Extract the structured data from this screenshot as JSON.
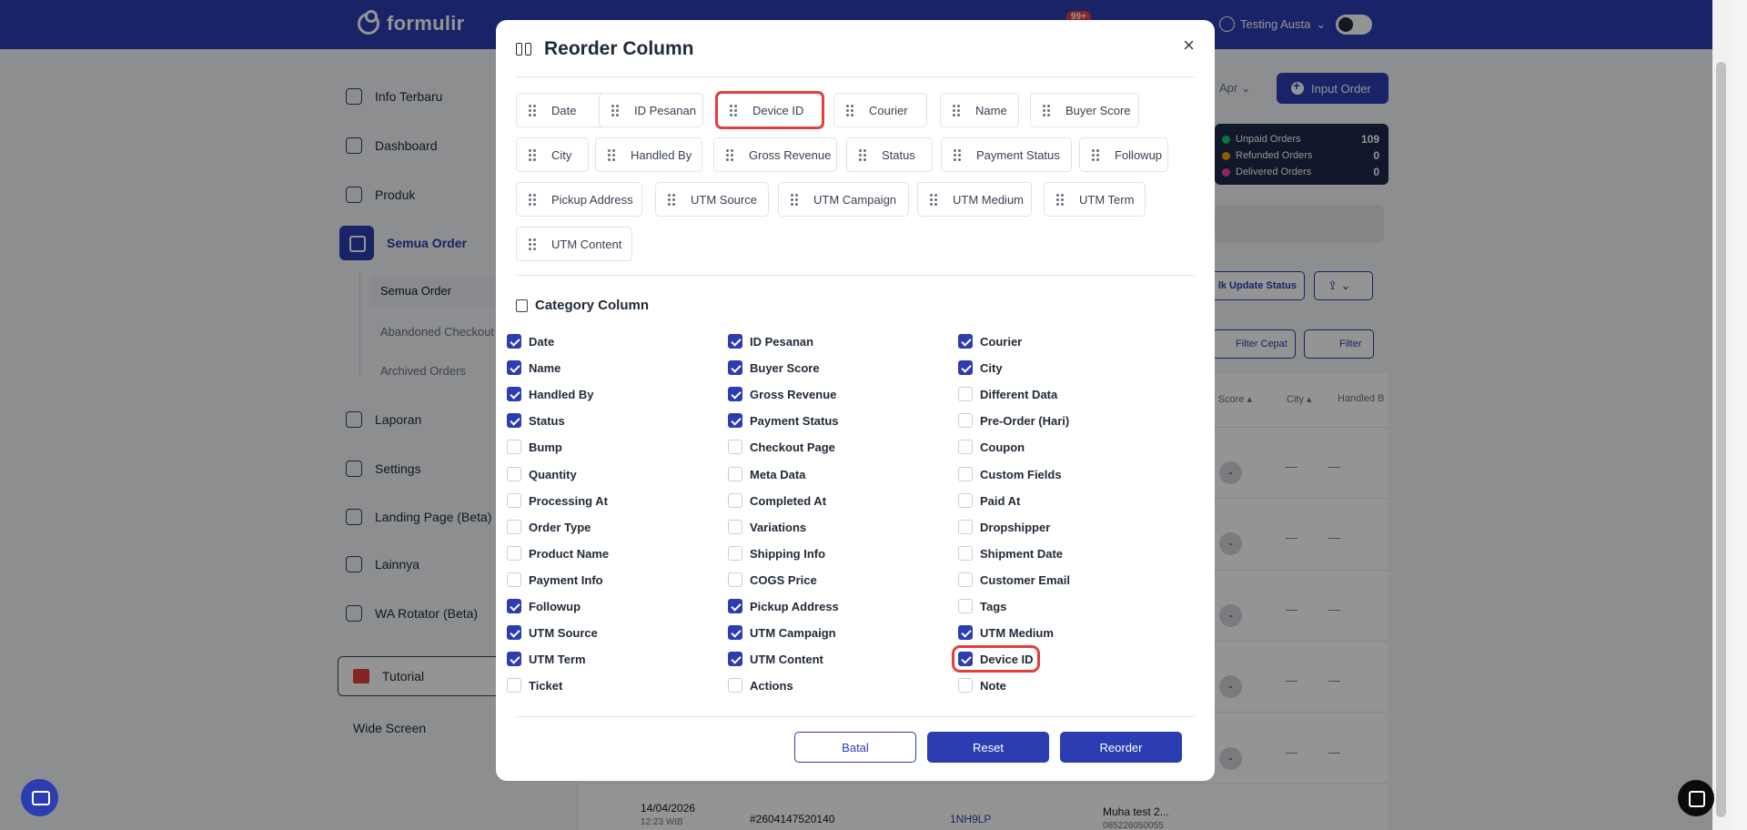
{
  "header": {
    "logo_text": "formulir",
    "notif_count": "99+",
    "user_name": "Testing Austa"
  },
  "sidebar": {
    "items": [
      {
        "label": "Info Terbaru",
        "icon": "megaphone-icon"
      },
      {
        "label": "Dashboard",
        "icon": "dashboard-icon"
      },
      {
        "label": "Produk",
        "icon": "box-icon"
      },
      {
        "label": "Semua Order",
        "icon": "cart-icon",
        "active": true
      },
      {
        "label": "Laporan",
        "icon": "report-icon"
      },
      {
        "label": "Settings",
        "icon": "gear-icon"
      },
      {
        "label": "Landing Page (Beta)",
        "icon": "page-icon"
      },
      {
        "label": "Lainnya",
        "icon": "more-icon"
      },
      {
        "label": "WA Rotator (Beta)",
        "icon": "whatsapp-icon"
      }
    ],
    "sub_items": [
      "Semua Order",
      "Abandoned Checkout",
      "Archived Orders"
    ],
    "tutorial": "Tutorial",
    "wide_screen": "Wide Screen"
  },
  "page": {
    "month": "Apr",
    "input_order": "Input Order",
    "stats": [
      {
        "label": "Unpaid Orders",
        "value": "109",
        "color": "#22c55e"
      },
      {
        "label": "Refunded Orders",
        "value": "0",
        "color": "#f59e0b"
      },
      {
        "label": "Delivered Orders",
        "value": "0",
        "color": "#ec4899"
      }
    ],
    "bulk_update": "lk Update Status",
    "filter_cepat": "Filter Cepat",
    "filter": "Filter",
    "col_buyer_score": "r Score",
    "col_city": "City",
    "col_handled_by": "Handled B",
    "dash": "—",
    "badge": "-",
    "last_row": {
      "date": "14/04/2026",
      "time": "12:23 WIB",
      "order_id": "#2604147520140",
      "code": "1NH9LP",
      "name": "Muha test 2...",
      "phone": "085226050055"
    }
  },
  "modal": {
    "title": "Reorder Column",
    "close": "×",
    "chips": [
      "Date",
      "ID Pesanan",
      "Device ID",
      "Courier",
      "Name",
      "Buyer Score",
      "City",
      "Handled By",
      "Gross Revenue",
      "Status",
      "Payment Status",
      "Followup",
      "Pickup Address",
      "UTM Source",
      "UTM Campaign",
      "UTM Medium",
      "UTM Term",
      "UTM Content"
    ],
    "category_title": "Category Column",
    "columns": [
      [
        "Date",
        "Name",
        "Handled By",
        "Status",
        "Bump",
        "Quantity",
        "Processing At",
        "Order Type",
        "Product Name",
        "Payment Info",
        "Followup",
        "UTM Source",
        "UTM Term",
        "Ticket"
      ],
      [
        "ID Pesanan",
        "Buyer Score",
        "Gross Revenue",
        "Payment Status",
        "Checkout Page",
        "Meta Data",
        "Completed At",
        "Variations",
        "Shipping Info",
        "COGS Price",
        "Pickup Address",
        "UTM Campaign",
        "UTM Content",
        "Actions"
      ],
      [
        "Courier",
        "City",
        "Different Data",
        "Pre-Order (Hari)",
        "Coupon",
        "Custom Fields",
        "Paid At",
        "Dropshipper",
        "Shipment Date",
        "Customer Email",
        "Tags",
        "UTM Medium",
        "Device ID",
        "Note"
      ]
    ],
    "checked": [
      [
        true,
        true,
        true,
        true,
        false,
        false,
        false,
        false,
        false,
        false,
        true,
        true,
        true,
        false
      ],
      [
        true,
        true,
        true,
        true,
        false,
        false,
        false,
        false,
        false,
        false,
        true,
        true,
        true,
        false
      ],
      [
        true,
        true,
        false,
        false,
        false,
        false,
        false,
        false,
        false,
        false,
        false,
        true,
        true,
        false
      ]
    ],
    "buttons": {
      "batal": "Batal",
      "reset": "Reset",
      "reorder": "Reorder"
    }
  }
}
